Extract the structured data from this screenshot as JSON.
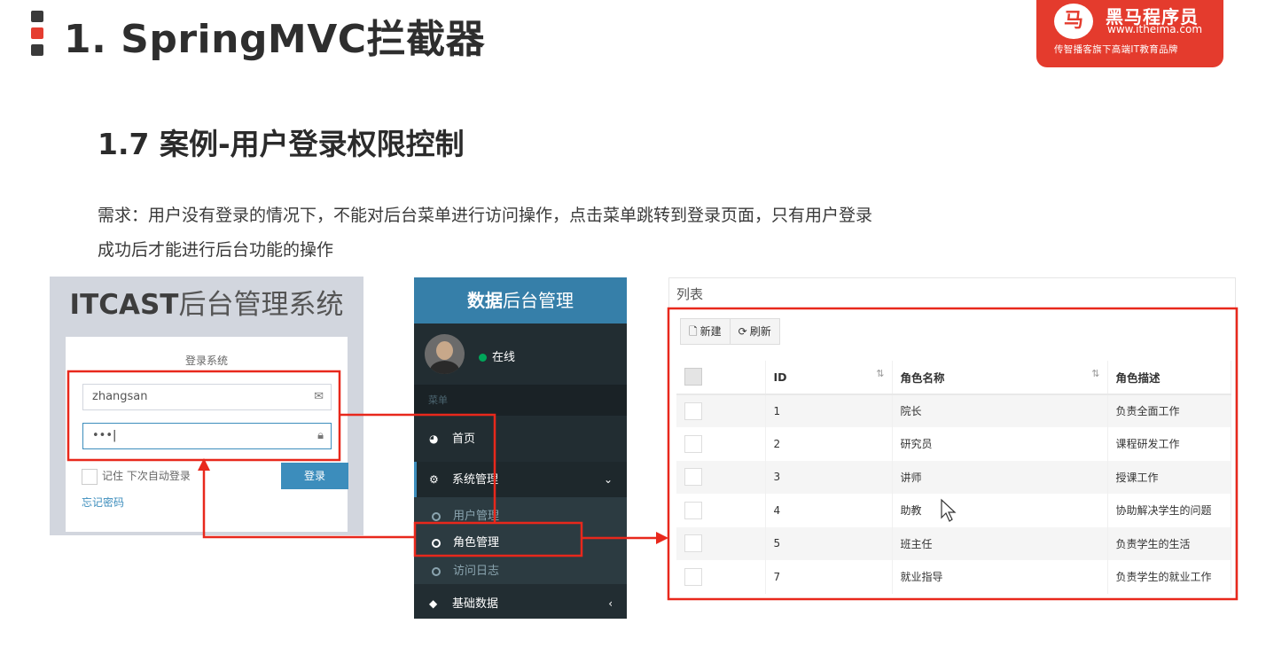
{
  "header": {
    "title": "1. SpringMVC拦截器",
    "brand": {
      "logo_glyph": "马",
      "name": "黑马程序员",
      "url": "www.itheima.com",
      "slogan": "传智播客旗下高端IT教育品牌",
      "color": "#e43b2d"
    }
  },
  "section": {
    "subtitle": "1.7 案例-用户登录权限控制",
    "requirement_line1": "需求：用户没有登录的情况下，不能对后台菜单进行访问操作，点击菜单跳转到登录页面，只有用户登录",
    "requirement_line2": "成功后才能进行后台功能的操作"
  },
  "login": {
    "title_bold": "ITCAST",
    "title_rest": "后台管理系统",
    "box_msg": "登录系统",
    "username_value": "zhangsan",
    "username_icon": "envelope-icon",
    "password_value": "•••",
    "password_icon": "lock-icon",
    "remember_label": "记住 下次自动登录",
    "submit_label": "登录",
    "forgot_label": "忘记密码",
    "accent": "#3c8dbc"
  },
  "admin": {
    "header_bold": "数据",
    "header_rest": "后台管理",
    "status": "在线",
    "menu_header": "菜单",
    "home": "首页",
    "system": "系统管理",
    "sub_items": [
      "用户管理",
      "角色管理",
      "访问日志"
    ],
    "base_data": "基础数据",
    "header_color": "#367fa9",
    "sidebar_color": "#222d32"
  },
  "list": {
    "title": "列表",
    "toolbar": {
      "new_label": "新建",
      "refresh_label": "刷新"
    },
    "columns": [
      "ID",
      "角色名称",
      "角色描述"
    ],
    "rows": [
      {
        "id": "1",
        "name": "院长",
        "desc": "负责全面工作"
      },
      {
        "id": "2",
        "name": "研究员",
        "desc": "课程研发工作"
      },
      {
        "id": "3",
        "name": "讲师",
        "desc": "授课工作"
      },
      {
        "id": "4",
        "name": "助教",
        "desc": "协助解决学生的问题"
      },
      {
        "id": "5",
        "name": "班主任",
        "desc": "负责学生的生活"
      },
      {
        "id": "7",
        "name": "就业指导",
        "desc": "负责学生的就业工作"
      }
    ]
  },
  "annotations": {
    "highlight_color": "#e8281c"
  }
}
